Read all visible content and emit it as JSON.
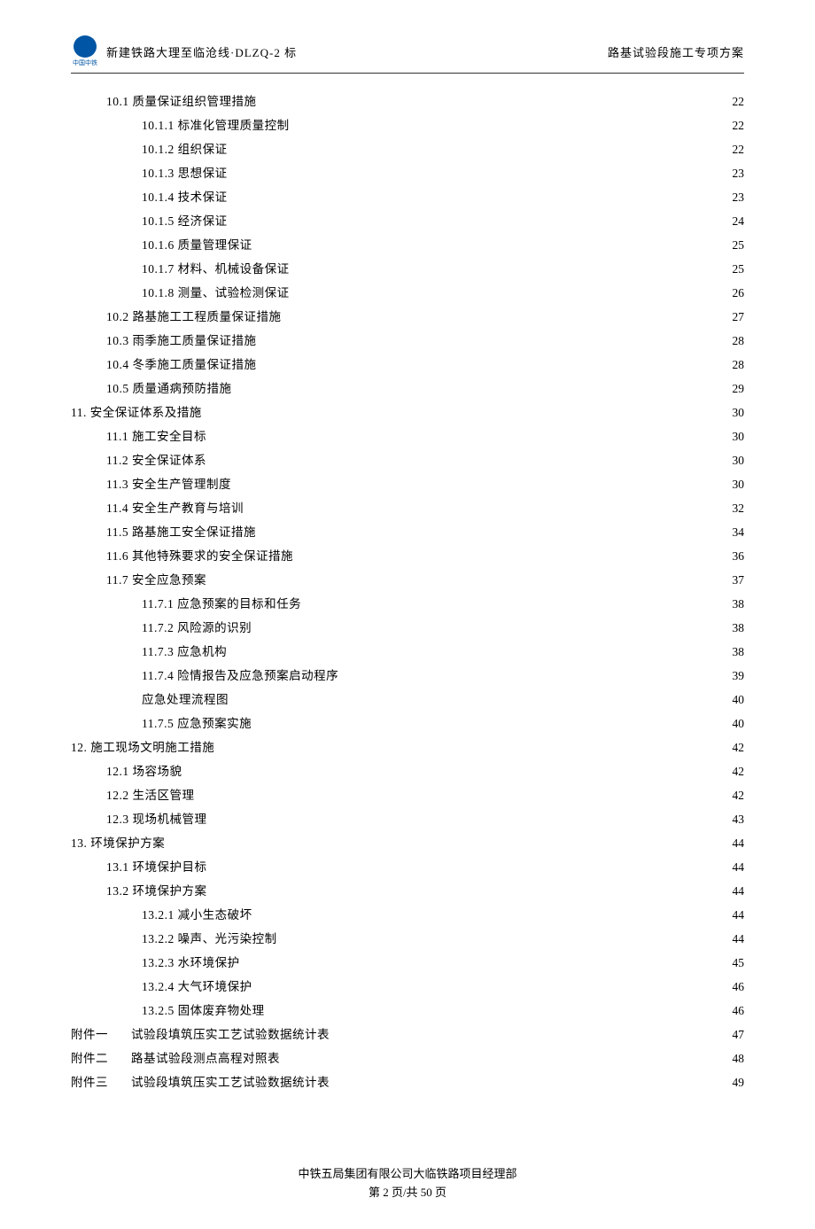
{
  "header": {
    "logo_label": "中国中铁",
    "title": "新建铁路大理至临沧线·DLZQ-2 标",
    "right": "路基试验段施工专项方案"
  },
  "toc": [
    {
      "level": 2,
      "label": "10.1 质量保证组织管理措施",
      "page": "22"
    },
    {
      "level": 3,
      "label": "10.1.1 标准化管理质量控制",
      "page": "22"
    },
    {
      "level": 3,
      "label": "10.1.2 组织保证",
      "page": "22"
    },
    {
      "level": 3,
      "label": "10.1.3 思想保证",
      "page": "23"
    },
    {
      "level": 3,
      "label": "10.1.4 技术保证",
      "page": "23"
    },
    {
      "level": 3,
      "label": "10.1.5 经济保证",
      "page": "24"
    },
    {
      "level": 3,
      "label": "10.1.6 质量管理保证",
      "page": "25"
    },
    {
      "level": 3,
      "label": "10.1.7 材料、机械设备保证",
      "page": "25"
    },
    {
      "level": 3,
      "label": "10.1.8 测量、试验检测保证",
      "page": "26"
    },
    {
      "level": 2,
      "label": "10.2 路基施工工程质量保证措施",
      "page": "27"
    },
    {
      "level": 2,
      "label": "10.3 雨季施工质量保证措施",
      "page": "28"
    },
    {
      "level": 2,
      "label": "10.4 冬季施工质量保证措施",
      "page": "28"
    },
    {
      "level": 2,
      "label": "10.5 质量通病预防措施",
      "page": "29"
    },
    {
      "level": 1,
      "label": "11. 安全保证体系及措施",
      "page": "30"
    },
    {
      "level": 2,
      "label": "11.1 施工安全目标",
      "page": "30"
    },
    {
      "level": 2,
      "label": "11.2 安全保证体系",
      "page": "30"
    },
    {
      "level": 2,
      "label": "11.3 安全生产管理制度",
      "page": "30"
    },
    {
      "level": 2,
      "label": "11.4 安全生产教育与培训",
      "page": "32"
    },
    {
      "level": 2,
      "label": "11.5 路基施工安全保证措施",
      "page": "34"
    },
    {
      "level": 2,
      "label": "11.6 其他特殊要求的安全保证措施",
      "page": "36"
    },
    {
      "level": 2,
      "label": "11.7 安全应急预案",
      "page": "37"
    },
    {
      "level": 3,
      "label": "11.7.1 应急预案的目标和任务",
      "page": "38"
    },
    {
      "level": 3,
      "label": "11.7.2 风险源的识别",
      "page": "38"
    },
    {
      "level": 3,
      "label": "11.7.3 应急机构",
      "page": "38"
    },
    {
      "level": 3,
      "label": "11.7.4 险情报告及应急预案启动程序",
      "page": "39"
    },
    {
      "level": 3,
      "label": "应急处理流程图",
      "page": "40"
    },
    {
      "level": 3,
      "label": "11.7.5 应急预案实施",
      "page": "40"
    },
    {
      "level": 1,
      "label": "12. 施工现场文明施工措施",
      "page": "42"
    },
    {
      "level": 2,
      "label": "12.1 场容场貌",
      "page": "42"
    },
    {
      "level": 2,
      "label": "12.2 生活区管理",
      "page": "42"
    },
    {
      "level": 2,
      "label": "12.3 现场机械管理",
      "page": "43"
    },
    {
      "level": 1,
      "label": "13. 环境保护方案",
      "page": "44"
    },
    {
      "level": 2,
      "label": "13.1 环境保护目标",
      "page": "44"
    },
    {
      "level": 2,
      "label": "13.2 环境保护方案",
      "page": "44"
    },
    {
      "level": 3,
      "label": "13.2.1 减小生态破坏",
      "page": "44"
    },
    {
      "level": 3,
      "label": "13.2.2 噪声、光污染控制",
      "page": "44"
    },
    {
      "level": 3,
      "label": "13.2.3 水环境保护",
      "page": "45"
    },
    {
      "level": 3,
      "label": "13.2.4 大气环境保护",
      "page": "46"
    },
    {
      "level": 3,
      "label": "13.2.5 固体废弃物处理",
      "page": "46"
    },
    {
      "level": 1,
      "prefix": "附件一",
      "label": "试验段填筑压实工艺试验数据统计表",
      "page": "47"
    },
    {
      "level": 1,
      "prefix": "附件二",
      "label": "路基试验段测点高程对照表",
      "page": "48"
    },
    {
      "level": 1,
      "prefix": "附件三",
      "label": "试验段填筑压实工艺试验数据统计表",
      "page": "49"
    }
  ],
  "footer": {
    "line1": "中铁五局集团有限公司大临铁路项目经理部",
    "line2": "第 2 页/共 50 页"
  }
}
